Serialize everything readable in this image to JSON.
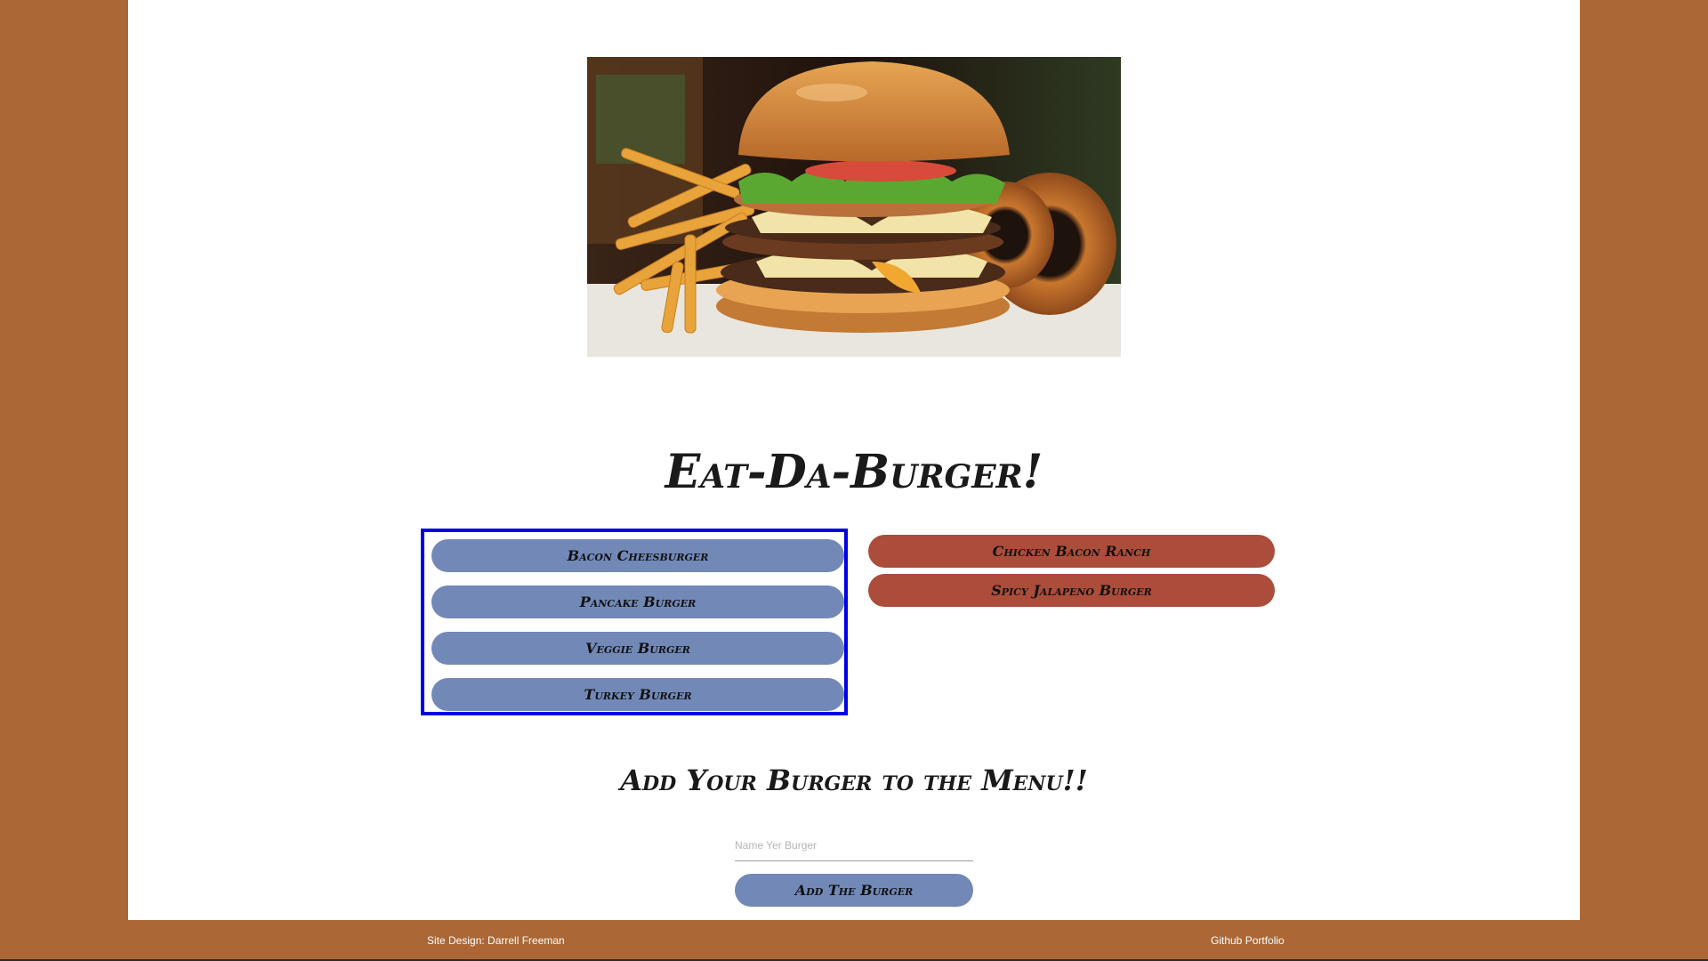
{
  "header": {
    "image_alt": "burger-photo"
  },
  "main": {
    "title": "Eat-Da-Burger!",
    "devour_list": [
      {
        "label": "Bacon Cheesburger"
      },
      {
        "label": "Pancake Burger"
      },
      {
        "label": "Veggie Burger"
      },
      {
        "label": "Turkey Burger"
      }
    ],
    "devoured_list": [
      {
        "label": "Chicken Bacon Ranch"
      },
      {
        "label": "Spicy Jalapeno Burger"
      }
    ]
  },
  "form": {
    "heading": "Add Your Burger to the Menu!!",
    "input_placeholder": "Name Yer Burger",
    "input_value": "",
    "submit_label": "Add The Burger"
  },
  "footer": {
    "credit": "Site Design: Darrell Freeman",
    "portfolio_link": "Github Portfolio"
  },
  "colors": {
    "background": "#ab6735",
    "page": "#ffffff",
    "devour_button": "#7289b8",
    "devoured_button": "#ab4d3a",
    "highlight_border": "#0000e6"
  }
}
